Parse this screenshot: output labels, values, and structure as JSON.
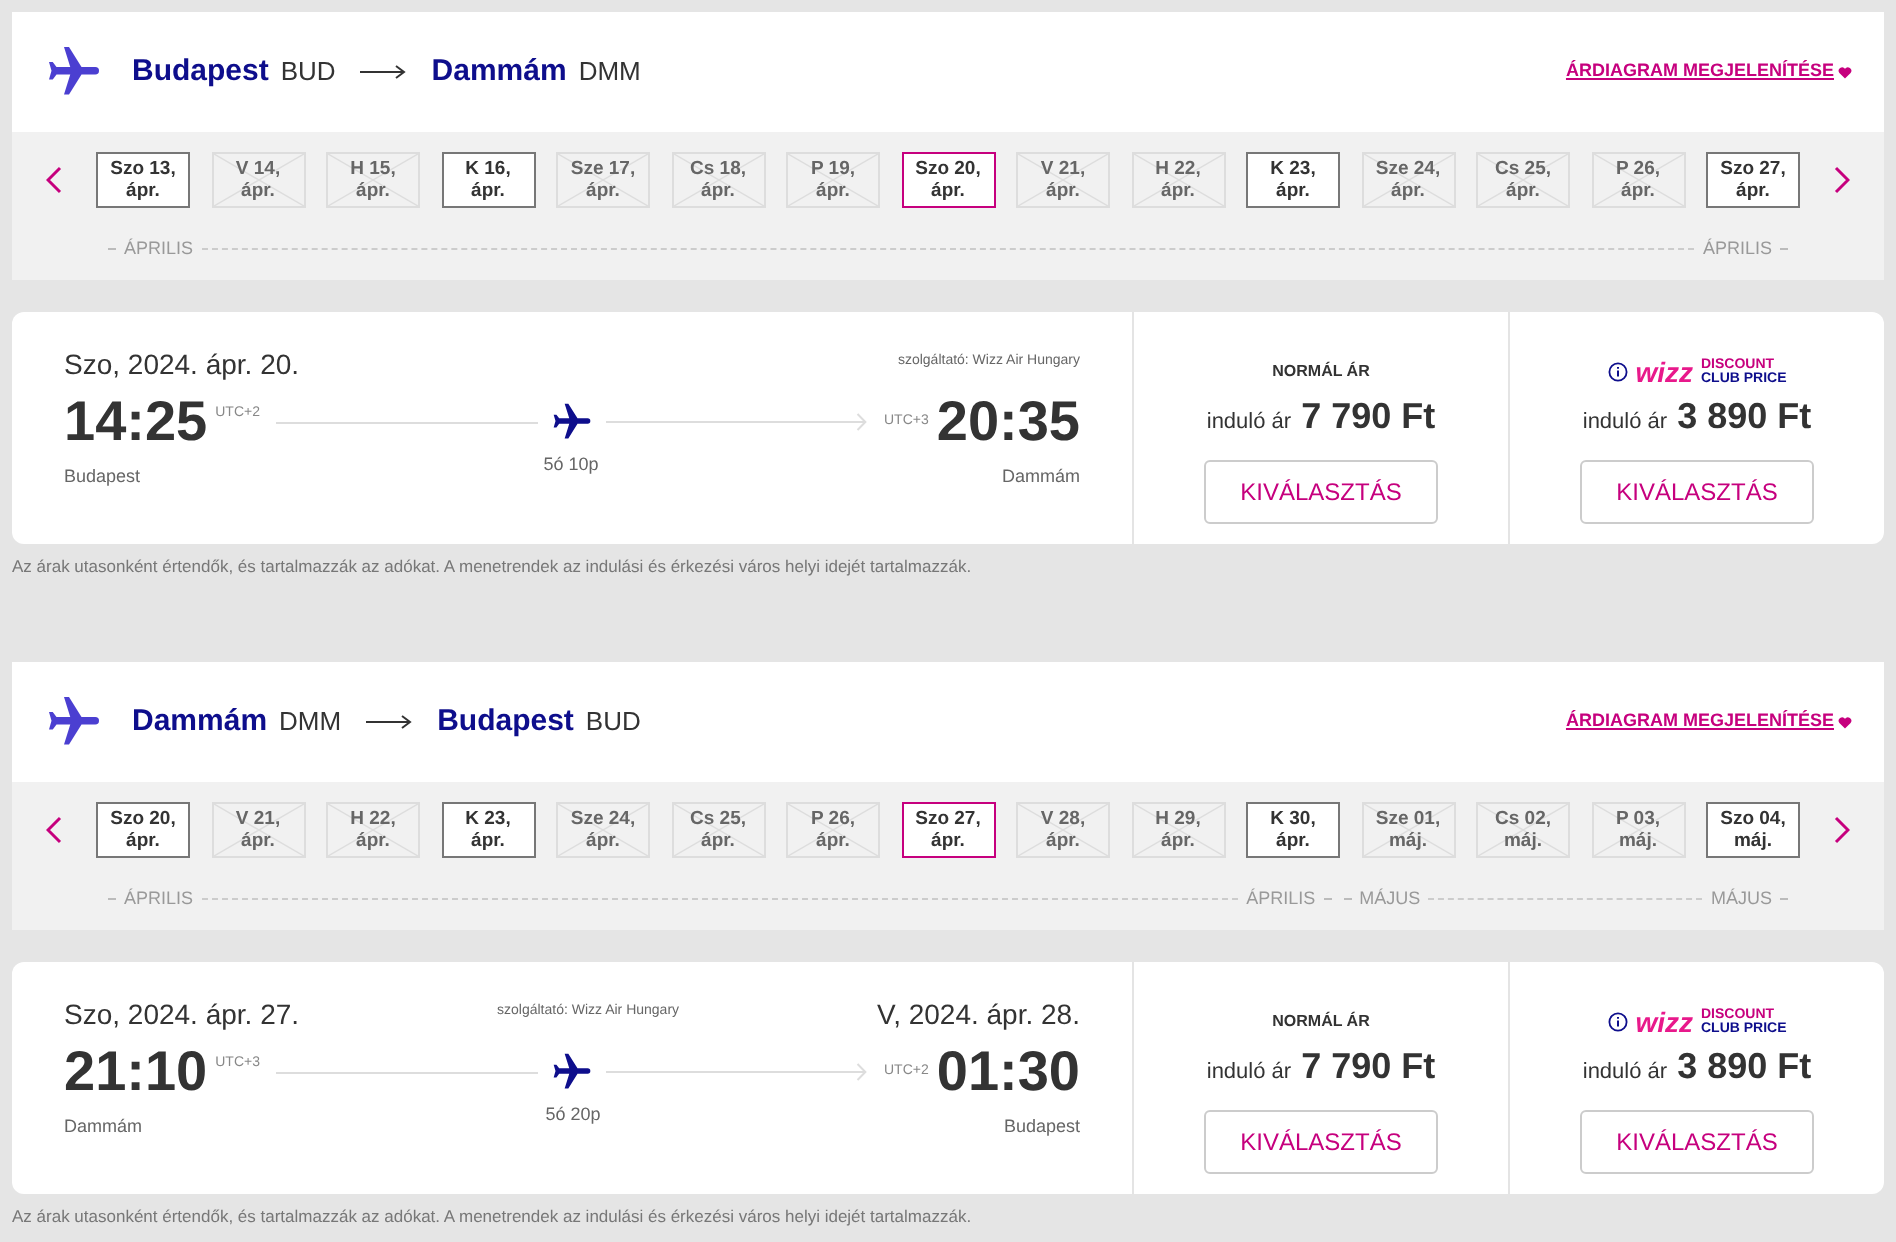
{
  "journeys": [
    {
      "from_city": "Budapest",
      "from_code": "BUD",
      "to_city": "Dammám",
      "to_code": "DMM",
      "chart_link": "ÁRDIAGRAM MEGJELENÍTÉSE",
      "dates": [
        {
          "day": "Szo 13,",
          "month": "ápr.",
          "available": true,
          "selected": false
        },
        {
          "day": "V 14,",
          "month": "ápr.",
          "available": false,
          "selected": false
        },
        {
          "day": "H 15,",
          "month": "ápr.",
          "available": false,
          "selected": false
        },
        {
          "day": "K 16,",
          "month": "ápr.",
          "available": true,
          "selected": false
        },
        {
          "day": "Sze 17,",
          "month": "ápr.",
          "available": false,
          "selected": false
        },
        {
          "day": "Cs 18,",
          "month": "ápr.",
          "available": false,
          "selected": false
        },
        {
          "day": "P 19,",
          "month": "ápr.",
          "available": false,
          "selected": false
        },
        {
          "day": "Szo 20,",
          "month": "ápr.",
          "available": true,
          "selected": true
        },
        {
          "day": "V 21,",
          "month": "ápr.",
          "available": false,
          "selected": false
        },
        {
          "day": "H 22,",
          "month": "ápr.",
          "available": false,
          "selected": false
        },
        {
          "day": "K 23,",
          "month": "ápr.",
          "available": true,
          "selected": false
        },
        {
          "day": "Sze 24,",
          "month": "ápr.",
          "available": false,
          "selected": false
        },
        {
          "day": "Cs 25,",
          "month": "ápr.",
          "available": false,
          "selected": false
        },
        {
          "day": "P 26,",
          "month": "ápr.",
          "available": false,
          "selected": false
        },
        {
          "day": "Szo 27,",
          "month": "ápr.",
          "available": true,
          "selected": false
        }
      ],
      "months": [
        {
          "start": "ÁPRILIS",
          "end": "ÁPRILIS"
        }
      ],
      "flight": {
        "depart_date": "Szo, 2024. ápr. 20.",
        "provider": "szolgáltató: Wizz Air Hungary",
        "depart_time": "14:25",
        "depart_tz": "UTC+2",
        "arrive_time": "20:35",
        "arrive_tz": "UTC+3",
        "duration": "5ó 10p",
        "depart_city": "Budapest",
        "arrive_city": "Dammám"
      },
      "fares": [
        {
          "kind": "normal",
          "title": "NORMÁL ÁR",
          "from_label": "induló ár",
          "price": "7 790 Ft",
          "button": "KIVÁLASZTÁS"
        },
        {
          "kind": "club",
          "logo_word": "wizz",
          "logo_line1": "DISCOUNT",
          "logo_line2": "CLUB PRICE",
          "from_label": "induló ár",
          "price": "3 890 Ft",
          "button": "KIVÁLASZTÁS"
        }
      ],
      "note": "Az árak utasonként értendők, és tartalmazzák az adókat. A menetrendek az indulási és érkezési város helyi idejét tartalmazzák."
    },
    {
      "from_city": "Dammám",
      "from_code": "DMM",
      "to_city": "Budapest",
      "to_code": "BUD",
      "chart_link": "ÁRDIAGRAM MEGJELENÍTÉSE",
      "dates": [
        {
          "day": "Szo 20,",
          "month": "ápr.",
          "available": true,
          "selected": false
        },
        {
          "day": "V 21,",
          "month": "ápr.",
          "available": false,
          "selected": false
        },
        {
          "day": "H 22,",
          "month": "ápr.",
          "available": false,
          "selected": false
        },
        {
          "day": "K 23,",
          "month": "ápr.",
          "available": true,
          "selected": false
        },
        {
          "day": "Sze 24,",
          "month": "ápr.",
          "available": false,
          "selected": false
        },
        {
          "day": "Cs 25,",
          "month": "ápr.",
          "available": false,
          "selected": false
        },
        {
          "day": "P 26,",
          "month": "ápr.",
          "available": false,
          "selected": false
        },
        {
          "day": "Szo 27,",
          "month": "ápr.",
          "available": true,
          "selected": true
        },
        {
          "day": "V 28,",
          "month": "ápr.",
          "available": false,
          "selected": false
        },
        {
          "day": "H 29,",
          "month": "ápr.",
          "available": false,
          "selected": false
        },
        {
          "day": "K 30,",
          "month": "ápr.",
          "available": true,
          "selected": false
        },
        {
          "day": "Sze 01,",
          "month": "máj.",
          "available": false,
          "selected": false
        },
        {
          "day": "Cs 02,",
          "month": "máj.",
          "available": false,
          "selected": false
        },
        {
          "day": "P 03,",
          "month": "máj.",
          "available": false,
          "selected": false
        },
        {
          "day": "Szo 04,",
          "month": "máj.",
          "available": true,
          "selected": false
        }
      ],
      "months": [
        {
          "start": "ÁPRILIS",
          "end": "ÁPRILIS"
        },
        {
          "start": "MÁJUS",
          "end": "MÁJUS"
        }
      ],
      "flight": {
        "depart_date": "Szo, 2024. ápr. 27.",
        "arrive_date": "V, 2024. ápr. 28.",
        "provider": "szolgáltató: Wizz Air Hungary",
        "depart_time": "21:10",
        "depart_tz": "UTC+3",
        "arrive_time": "01:30",
        "arrive_tz": "UTC+2",
        "duration": "5ó 20p",
        "depart_city": "Dammám",
        "arrive_city": "Budapest"
      },
      "fares": [
        {
          "kind": "normal",
          "title": "NORMÁL ÁR",
          "from_label": "induló ár",
          "price": "7 790 Ft",
          "button": "KIVÁLASZTÁS"
        },
        {
          "kind": "club",
          "logo_word": "wizz",
          "logo_line1": "DISCOUNT",
          "logo_line2": "CLUB PRICE",
          "from_label": "induló ár",
          "price": "3 890 Ft",
          "button": "KIVÁLASZTÁS"
        }
      ],
      "note": "Az árak utasonként értendők, és tartalmazzák az adókat. A menetrendek az indulási és érkezési város helyi idejét tartalmazzák."
    }
  ]
}
